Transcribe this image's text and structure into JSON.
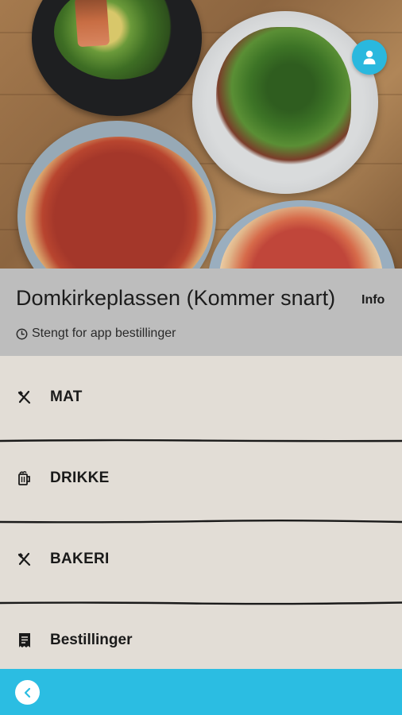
{
  "location": {
    "title": "Domkirkeplassen (Kommer snart)",
    "info_label": "Info",
    "status": "Stengt for app bestillinger"
  },
  "menu": {
    "items": [
      {
        "label": "MAT",
        "icon": "cutlery-icon"
      },
      {
        "label": "DRIKKE",
        "icon": "beer-mug-icon"
      },
      {
        "label": "BAKERI",
        "icon": "cutlery-icon"
      },
      {
        "label": "Bestillinger",
        "icon": "receipt-icon"
      }
    ]
  },
  "colors": {
    "accent": "#2bbde2",
    "header_bg": "#bdbdbd",
    "menu_bg": "#e2ddd6"
  }
}
